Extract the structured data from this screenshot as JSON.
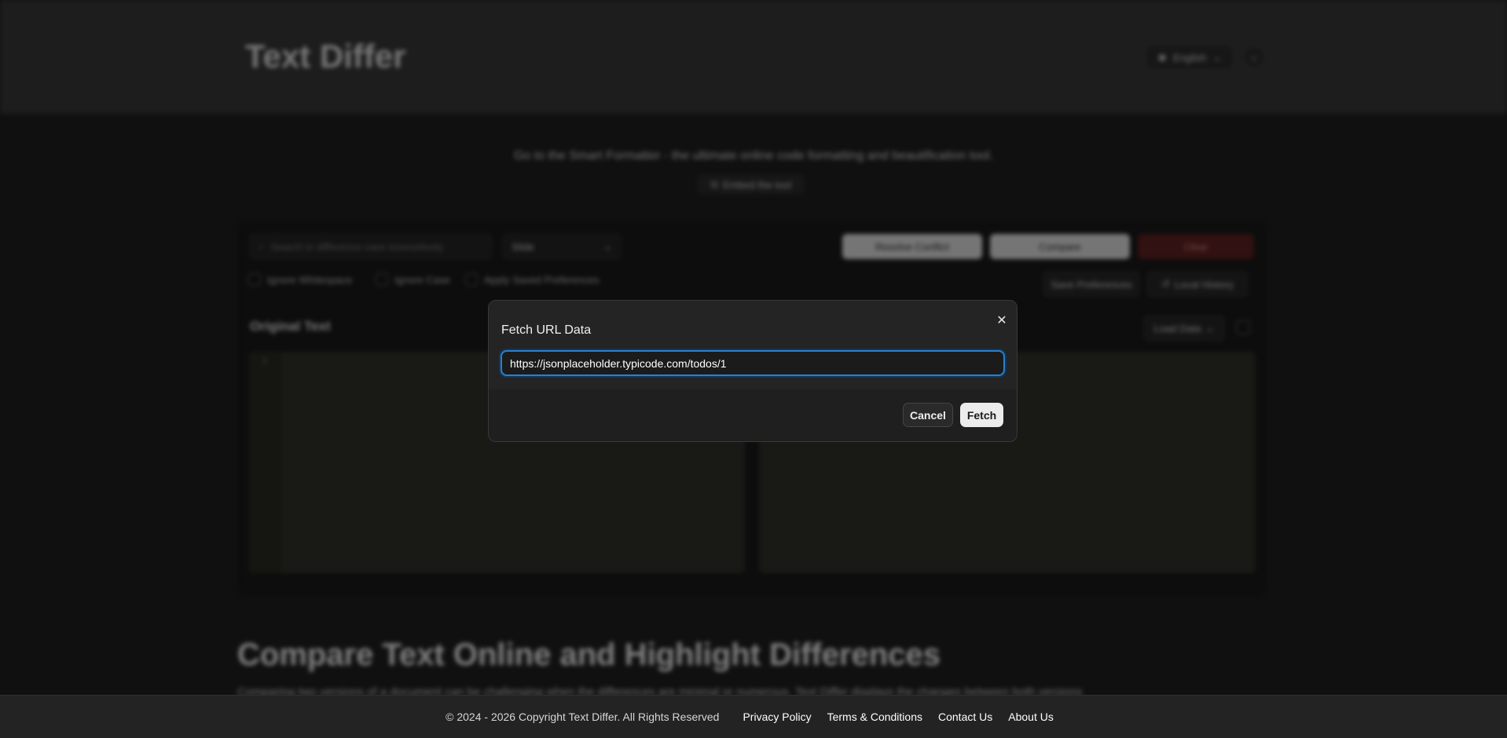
{
  "header": {
    "logo": "Text Differ",
    "language": "English",
    "globe_icon": "globe-icon",
    "theme_icon": "theme-toggle-icon"
  },
  "promo": {
    "text": "Go to the Smart Formatter - the ultimate online code formatting and beautification tool.",
    "embed_label": "Embed the tool"
  },
  "toolbar": {
    "search_placeholder": "Search in difference case insensitively",
    "view_mode": "Slide",
    "resolve_label": "Resolve Conflict",
    "compare_label": "Compare",
    "clear_label": "Clear",
    "options": [
      "Ignore Whitespace",
      "Ignore Case",
      "Apply Saved Preferences"
    ],
    "save_preferences_label": "Save Preferences",
    "local_history_label": "Local History"
  },
  "panes": {
    "original_title": "Original Text",
    "load_data_label": "Load Data",
    "line_number": "1"
  },
  "seo": {
    "title": "Compare Text Online and Highlight Differences",
    "text": "Comparing two versions of a document can be challenging when the differences are minimal or numerous. Text Differ displays the changes between both versions"
  },
  "modal": {
    "title": "Fetch URL Data",
    "url_value": "https://jsonplaceholder.typicode.com/todos/1",
    "cancel_label": "Cancel",
    "fetch_label": "Fetch",
    "close_glyph": "✕"
  },
  "footer": {
    "copyright": "© 2024 - 2026 Copyright Text Differ. All Rights Reserved",
    "links": [
      "Privacy Policy",
      "Terms & Conditions",
      "Contact Us",
      "About Us"
    ]
  },
  "colors": {
    "accent_focus": "#2c7fc9",
    "page_bg": "#1e1e1e",
    "clear_button": "#5a1f1f"
  }
}
